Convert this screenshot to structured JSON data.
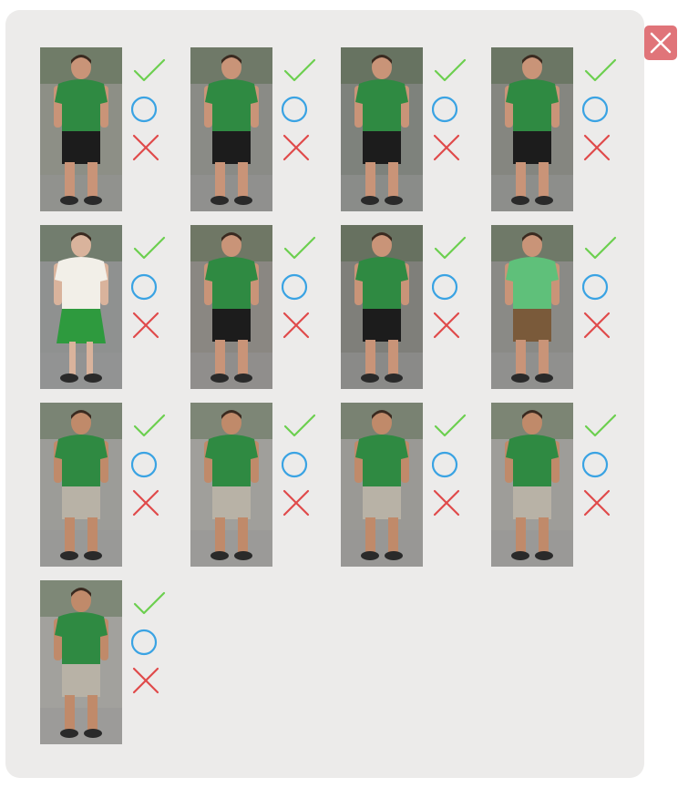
{
  "colors": {
    "panel_bg": "#ecebea",
    "close_bg": "#e07479",
    "check": "#6ccf4f",
    "circle": "#3aa3e3",
    "cross": "#e04a4a"
  },
  "icons": {
    "close": "close-icon",
    "accept": "check-icon",
    "neutral": "circle-icon",
    "reject": "cross-icon"
  },
  "items": [
    {
      "shirt": "#2f8a42",
      "legs": "#1c1c1c",
      "skin": "#c99478",
      "bg": "#8d8f86",
      "view": "front"
    },
    {
      "shirt": "#2f8a42",
      "legs": "#1c1c1c",
      "skin": "#c99478",
      "bg": "#8a8b86",
      "view": "front"
    },
    {
      "shirt": "#2f8a42",
      "legs": "#1c1c1c",
      "skin": "#c99478",
      "bg": "#7e827c",
      "view": "back"
    },
    {
      "shirt": "#2f8a42",
      "legs": "#1c1c1c",
      "skin": "#c99478",
      "bg": "#858680",
      "view": "back"
    },
    {
      "shirt": "#f2efe8",
      "legs": "#2e9a3e",
      "skin": "#d9b39c",
      "bg": "#8f9190",
      "view": "back"
    },
    {
      "shirt": "#2f8a42",
      "legs": "#1c1c1c",
      "skin": "#c99478",
      "bg": "#8a8782",
      "view": "back"
    },
    {
      "shirt": "#2f8a42",
      "legs": "#1c1c1c",
      "skin": "#c99478",
      "bg": "#7f7f7a",
      "view": "back"
    },
    {
      "shirt": "#5fc07a",
      "legs": "#7a5a3a",
      "skin": "#c99478",
      "bg": "#8a8a86",
      "view": "side"
    },
    {
      "shirt": "#2f8a42",
      "legs": "#b8b2a6",
      "skin": "#c08a6a",
      "bg": "#9c9c98",
      "view": "front"
    },
    {
      "shirt": "#2f8a42",
      "legs": "#b8b2a6",
      "skin": "#c08a6a",
      "bg": "#a09f9b",
      "view": "front"
    },
    {
      "shirt": "#2f8a42",
      "legs": "#b8b2a6",
      "skin": "#c08a6a",
      "bg": "#9a9995",
      "view": "front"
    },
    {
      "shirt": "#2f8a42",
      "legs": "#b8b2a6",
      "skin": "#c08a6a",
      "bg": "#9e9d99",
      "view": "front"
    },
    {
      "shirt": "#2f8a42",
      "legs": "#b8b2a6",
      "skin": "#c08a6a",
      "bg": "#a2a19d",
      "view": "front"
    }
  ]
}
